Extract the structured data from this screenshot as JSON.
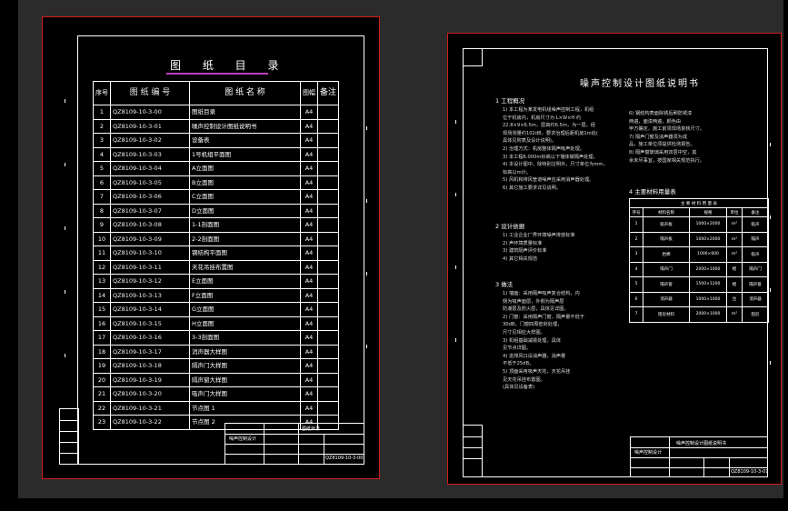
{
  "sheet1": {
    "title": "图 纸 目 录",
    "headers": [
      "序号",
      "图 纸 编 号",
      "图 纸 名 称",
      "图幅",
      "备注"
    ],
    "rows": [
      [
        "1",
        "QZ8109-10-3-00",
        "图纸目录",
        "A4",
        ""
      ],
      [
        "2",
        "QZ8109-10-3-01",
        "噪声控制设计图纸说明书",
        "A4",
        ""
      ],
      [
        "3",
        "QZ8109-10-3-02",
        "设备表",
        "A4",
        ""
      ],
      [
        "4",
        "QZ8109-10-3-03",
        "1号机组平面图",
        "A4",
        ""
      ],
      [
        "5",
        "QZ8109-10-3-04",
        "A立面图",
        "A4",
        ""
      ],
      [
        "6",
        "QZ8109-10-3-05",
        "B立面图",
        "A4",
        ""
      ],
      [
        "7",
        "QZ8109-10-3-06",
        "C立面图",
        "A4",
        ""
      ],
      [
        "8",
        "QZ8109-10-3-07",
        "D立面图",
        "A4",
        ""
      ],
      [
        "9",
        "QZ8109-10-3-08",
        "1-1剖面图",
        "A4",
        ""
      ],
      [
        "10",
        "QZ8109-10-3-09",
        "2-2剖面图",
        "A4",
        ""
      ],
      [
        "11",
        "QZ8109-10-3-10",
        "钢结构平面图",
        "A4",
        ""
      ],
      [
        "12",
        "QZ8109-10-3-11",
        "天花吊挂布置图",
        "A4",
        ""
      ],
      [
        "13",
        "QZ8109-10-3-12",
        "E立面图",
        "A4",
        ""
      ],
      [
        "14",
        "QZ8109-10-3-13",
        "F立面图",
        "A4",
        ""
      ],
      [
        "15",
        "QZ8109-10-3-14",
        "G立面图",
        "A4",
        ""
      ],
      [
        "16",
        "QZ8109-10-3-15",
        "H立面图",
        "A4",
        ""
      ],
      [
        "17",
        "QZ8109-10-3-16",
        "3-3剖面图",
        "A4",
        ""
      ],
      [
        "18",
        "QZ8109-10-3-17",
        "消声器大样图",
        "A4",
        ""
      ],
      [
        "19",
        "QZ8109-10-3-18",
        "隔声门大样图",
        "A4",
        ""
      ],
      [
        "20",
        "QZ8109-10-3-19",
        "隔声窗大样图",
        "A4",
        ""
      ],
      [
        "21",
        "QZ8109-10-3-20",
        "吸声门大样图",
        "A4",
        ""
      ],
      [
        "22",
        "QZ8109-10-3-21",
        "节点图 1",
        "A4",
        ""
      ],
      [
        "23",
        "QZ8109-10-3-22",
        "节点图 2",
        "A4",
        ""
      ]
    ],
    "title_block": {
      "drawing_name": "图纸目录",
      "project": "噪声控制设计",
      "drawing_no": "QZ8109-10-3-00"
    }
  },
  "sheet2": {
    "title": "噪声控制设计图纸说明书",
    "sec1": "1  工程概况",
    "sec1_lines": [
      "1) 本工程为某发电机组噪声控制工程，机组",
      "位于机房内，机房尺寸为 L×W×H 约",
      "22.8×9×6.5m，层高约6.5m，为一层。经",
      "现场测量约102dB，要求治理后距机房1m处(",
      "具体见附表及设计说明)。",
      "2) 治理方式：机房整体隔声吸声处理。",
      "3) 本工程6.000m标高以下墙体做隔声处理，",
      "4) 本设计图中，除特别注明外，尺寸单位为mm，",
      "标高以m计。",
      "5) 风机和排风管道噪声应采用消声器处理。",
      "6) 其它施工要求详见说明。"
    ],
    "sec2": "2  设计依据",
    "sec2_lines": [
      "1) 工业企业厂界环境噪声排放标准",
      "2) 声环境质量标准",
      "3) 建筑隔声评价标准",
      "4) 其它相关规范"
    ],
    "sec3": "3  做法",
    "sec3_lines": [
      "1) 墙面：采用隔声吸声复合结构，内",
      "侧为吸声面层，外侧为隔声层",
      "防潮层及防火层，具体见详图。",
      "2) 门窗：采用隔声门窗，隔声量不低于",
      "30dB，门窗四周密封处理，",
      "尺寸见相应大样图。",
      "3) 机组基础减振处理，具体",
      "见节点详图。",
      "4) 进排风口设消声器，消声量",
      "不低于25dB。",
      "5) 顶面采用吸声天花，天花吊挂",
      "见天花吊挂布置图。",
      "(具体见设备表)"
    ],
    "right_lines": [
      "6) 钢结构表面除锈后刷防锈漆",
      "两遍，面漆两遍，颜色由",
      "甲方确定，施工前须现场复核尺寸。",
      "7) 隔声门窗及消声器须为成",
      "品，施工单位须提供检测报告。",
      "8) 隔声窗玻璃采用双层中空，其",
      "余未尽事宜，按国家相关规范执行。"
    ],
    "sec4": "4  主要材料用量表",
    "mat_caption": "主 要 材 料 用 量 表",
    "mat_headers": [
      "序号",
      "材料名称",
      "规格",
      "单位",
      "备注"
    ],
    "mat_rows": [
      [
        "1",
        "吸声板",
        "1000×2000",
        "m²",
        "吸声"
      ],
      [
        "2",
        "隔声板",
        "1000×2000",
        "m²",
        "隔声"
      ],
      [
        "3",
        "岩棉",
        "1000×600",
        "m²",
        "吸声"
      ],
      [
        "4",
        "隔声门",
        "2000×1000",
        "樘",
        "隔声门"
      ],
      [
        "5",
        "隔声窗",
        "1500×1200",
        "樘",
        "隔声窗"
      ],
      [
        "6",
        "消声器",
        "1000×1000",
        "台",
        "消声器"
      ],
      [
        "7",
        "阻尼材料",
        "2000×1000",
        "m²",
        "阻尼"
      ]
    ],
    "title_block": {
      "drawing_name": "噪声控制设计图纸说明书",
      "project": "噪声控制设计",
      "drawing_no": "QZ8109-10-3-01"
    }
  }
}
